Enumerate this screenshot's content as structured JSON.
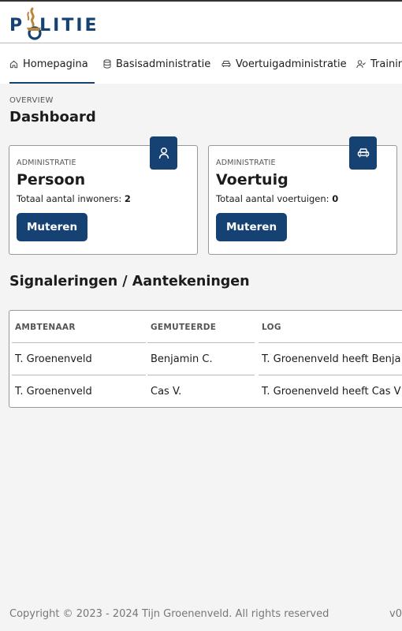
{
  "brand": {
    "logo_text_left": "P",
    "logo_text_right": "LITIE",
    "logo_name": "POLITIE"
  },
  "nav": {
    "items": [
      {
        "label": "Homepagina",
        "icon": "home-icon",
        "active": true
      },
      {
        "label": "Basisadministratie",
        "icon": "database-icon",
        "active": false
      },
      {
        "label": "Voertuigadministratie",
        "icon": "car-icon",
        "active": false
      },
      {
        "label": "Training",
        "icon": "user-check-icon",
        "active": false
      }
    ]
  },
  "page": {
    "overview": "OVERVIEW",
    "title": "Dashboard"
  },
  "cards": [
    {
      "label": "ADMINISTRATIE",
      "title": "Persoon",
      "stat_label": "Totaal aantal inwoners:",
      "stat_value": "2",
      "button": "Muteren",
      "icon": "user-icon"
    },
    {
      "label": "ADMINISTRATIE",
      "title": "Voertuig",
      "stat_label": "Totaal aantal voertuigen:",
      "stat_value": "0",
      "button": "Muteren",
      "icon": "car-icon"
    }
  ],
  "section": {
    "title": "Signaleringen / Aantekeningen"
  },
  "table": {
    "headers": [
      "AMBTENAAR",
      "GEMUTEERDE",
      "LOG"
    ],
    "rows": [
      [
        "T. Groenenveld",
        "Benjamin C.",
        "T. Groenenveld heeft Benja"
      ],
      [
        "T. Groenenveld",
        "Cas V.",
        "T. Groenenveld heeft Cas V"
      ]
    ]
  },
  "footer": {
    "copyright": "Copyright © 2023 - 2024 Tijn Groenenveld. All rights reserved",
    "version": "v0"
  },
  "colors": {
    "primary": "#154273",
    "gold": "#b8853a",
    "background": "#f4f4f4"
  }
}
